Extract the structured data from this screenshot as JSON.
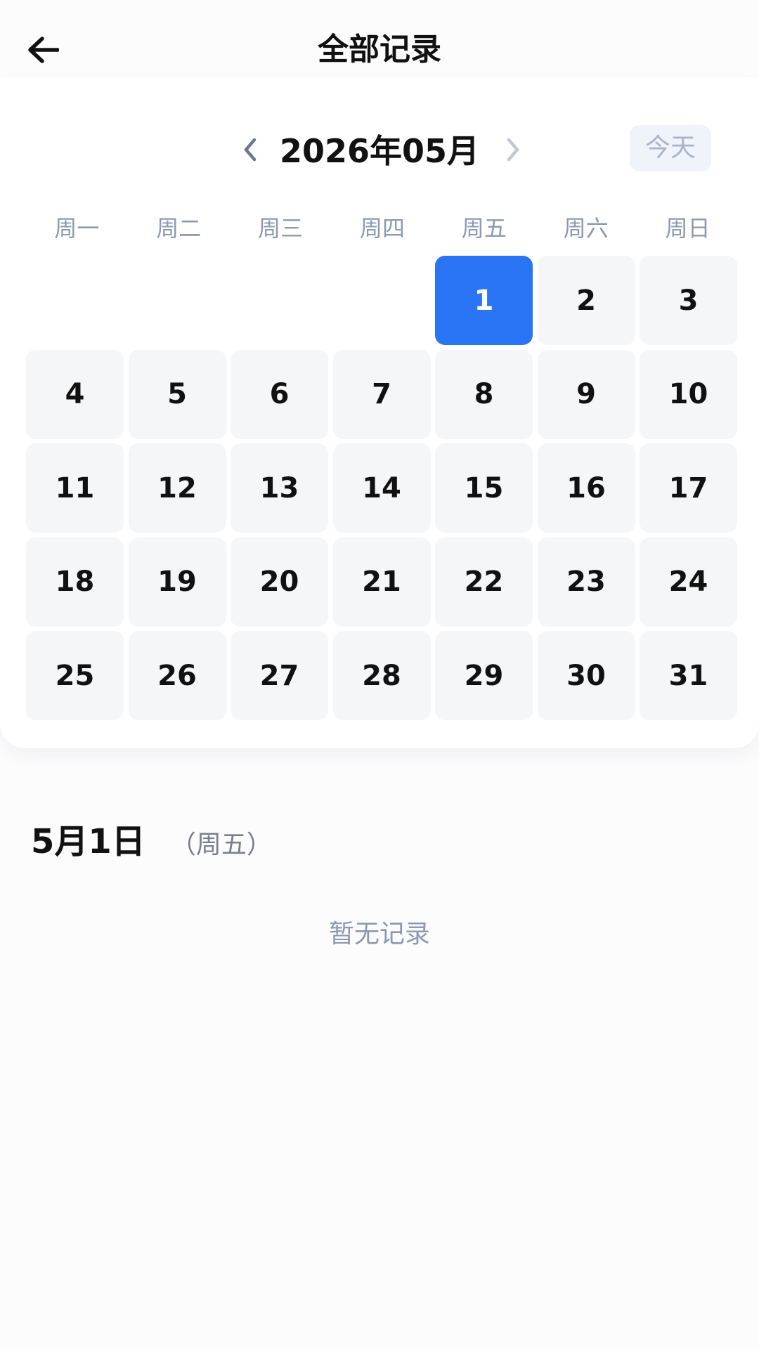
{
  "header": {
    "title": "全部记录",
    "back_icon": "arrow-left-icon"
  },
  "calendar": {
    "month_title": "2026年05月",
    "today_label": "今天",
    "prev_icon": "chevron-left-icon",
    "next_icon": "chevron-right-icon",
    "weekdays": [
      "周一",
      "周二",
      "周三",
      "周四",
      "周五",
      "周六",
      "周日"
    ],
    "leading_blanks": 4,
    "days": [
      "1",
      "2",
      "3",
      "4",
      "5",
      "6",
      "7",
      "8",
      "9",
      "10",
      "11",
      "12",
      "13",
      "14",
      "15",
      "16",
      "17",
      "18",
      "19",
      "20",
      "21",
      "22",
      "23",
      "24",
      "25",
      "26",
      "27",
      "28",
      "29",
      "30",
      "31"
    ],
    "selected_day": "1",
    "colors": {
      "selected_bg": "#2a74f6",
      "cell_bg": "#f5f6f8",
      "weekday_text": "#8c98b4"
    }
  },
  "selected_date": {
    "title": "5月1日",
    "weekday": "（周五）"
  },
  "records": {
    "empty_text": "暂无记录"
  }
}
